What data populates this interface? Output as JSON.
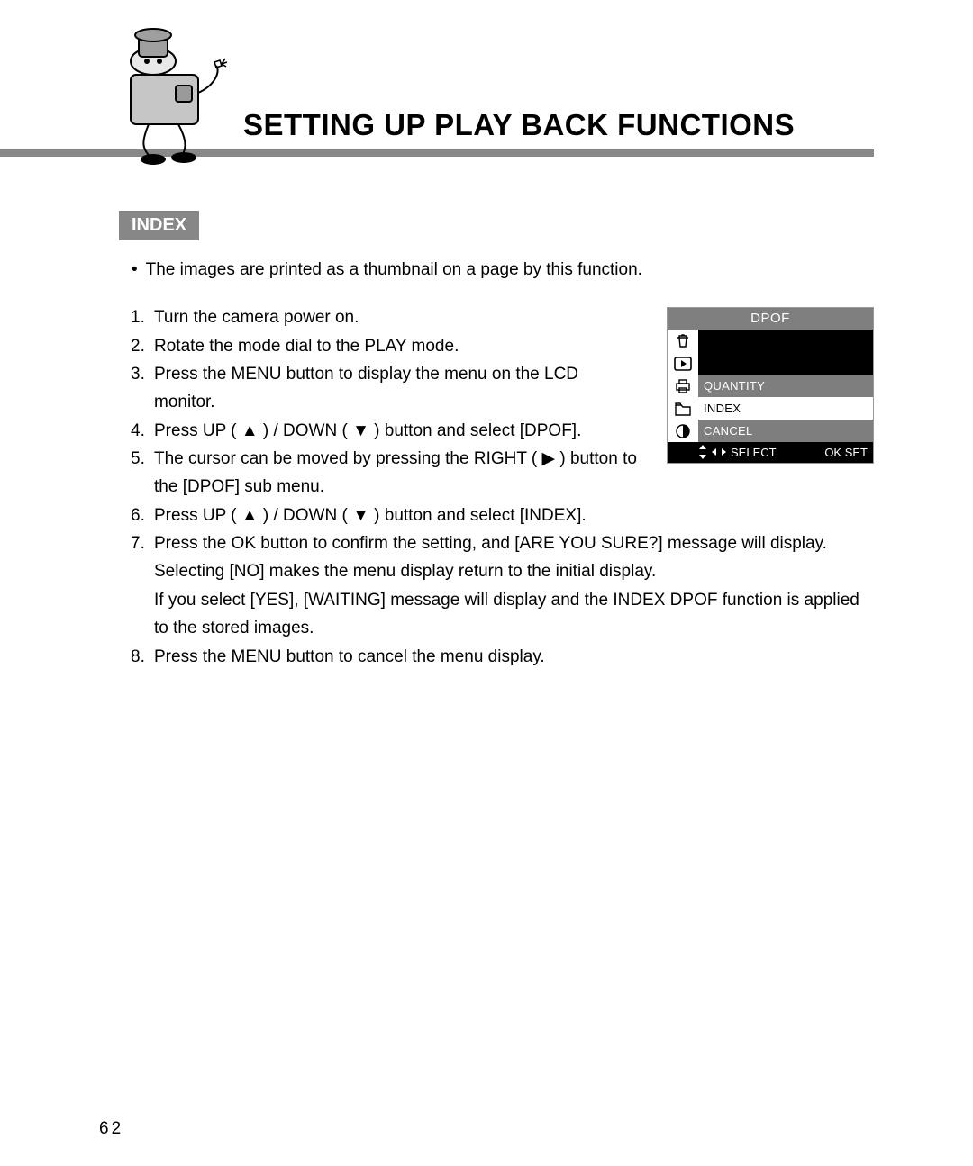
{
  "title": "SETTING UP PLAY BACK FUNCTIONS",
  "section_badge": "INDEX",
  "bullet_text": "The images are printed as a thumbnail on a page by this function.",
  "steps": [
    "Turn the camera power on.",
    "Rotate the mode dial to the PLAY mode.",
    "Press the MENU button to display the menu on the LCD monitor.",
    "Press UP ( ▲ ) / DOWN ( ▼ ) button and select [DPOF].",
    "The cursor can be moved by pressing the RIGHT ( ▶ ) button to the [DPOF] sub menu.",
    "Press UP ( ▲ ) / DOWN ( ▼ ) button and select [INDEX]."
  ],
  "steps_continued": [
    {
      "num": "7.",
      "text": "Press the OK button to confirm the setting, and [ARE YOU SURE?] message will display. Selecting [NO] makes the menu display return to the initial display."
    },
    {
      "num": "",
      "text": "If you select [YES], [WAITING] message will display and the INDEX DPOF function is applied to the stored images."
    },
    {
      "num": "8.",
      "text": "Press the MENU button to cancel the menu display."
    }
  ],
  "lcd": {
    "title": "DPOF",
    "rows": [
      {
        "label": "",
        "class": "blk"
      },
      {
        "label": "",
        "class": "blk"
      },
      {
        "label": "QUANTITY",
        "class": "gray"
      },
      {
        "label": "INDEX",
        "class": "sel"
      },
      {
        "label": "CANCEL",
        "class": "gray"
      }
    ],
    "footer_select": "SELECT",
    "footer_set": "OK SET"
  },
  "page_number": "62"
}
